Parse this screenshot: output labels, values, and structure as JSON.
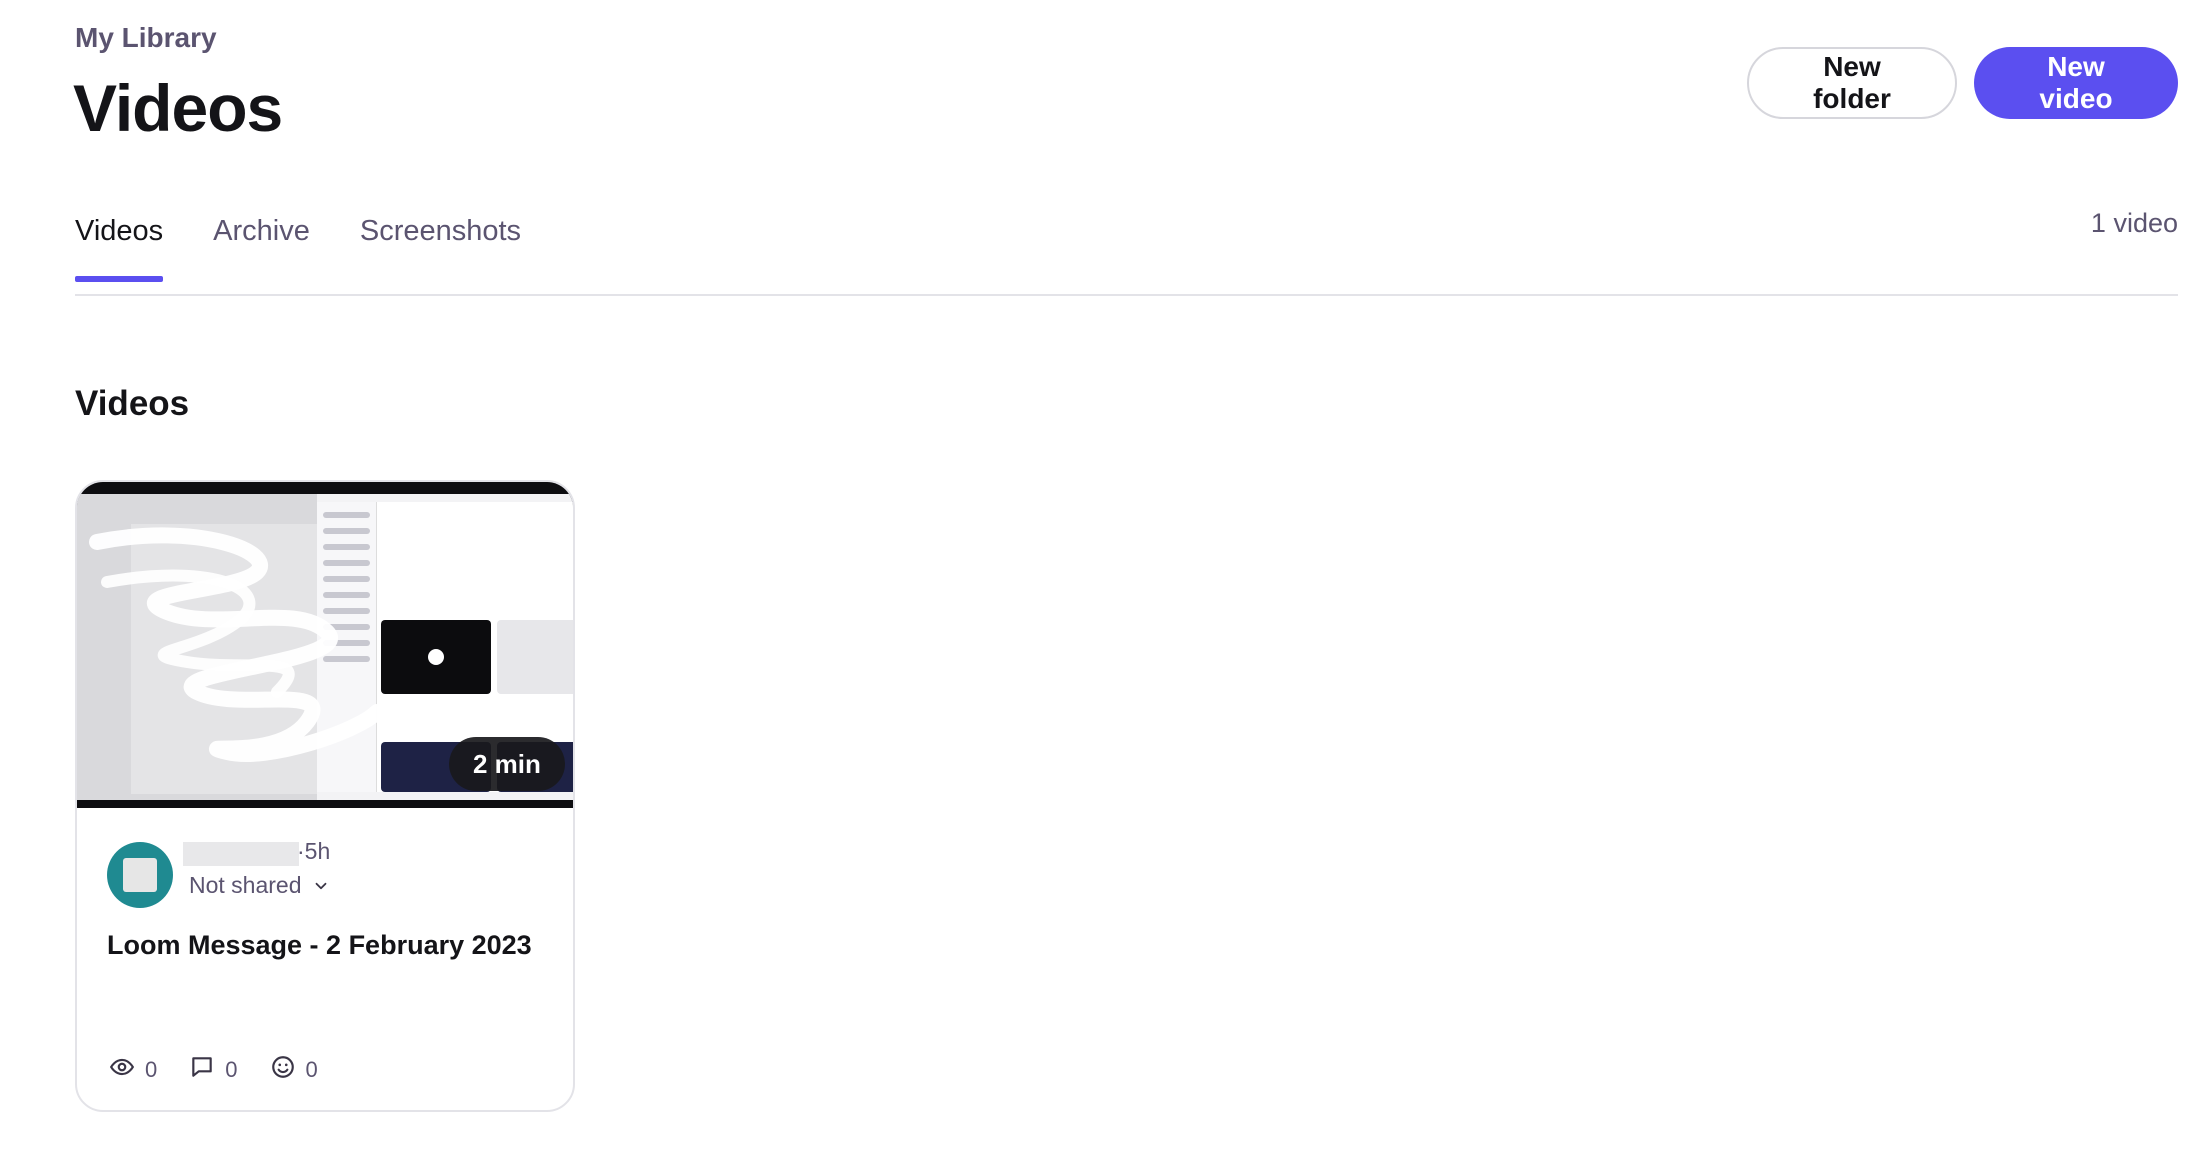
{
  "header": {
    "breadcrumb": "My Library",
    "title": "Videos",
    "actions": {
      "new_folder": "New folder",
      "new_video": "New video"
    }
  },
  "tabs": [
    {
      "label": "Videos",
      "active": true
    },
    {
      "label": "Archive",
      "active": false
    },
    {
      "label": "Screenshots",
      "active": false
    }
  ],
  "video_count": "1 video",
  "section": {
    "title": "Videos"
  },
  "videos": [
    {
      "duration": "2 min",
      "time_ago": "·5h",
      "share_status": "Not shared",
      "title": "Loom Message - 2 February 2023",
      "views": "0",
      "comments": "0",
      "reactions": "0"
    }
  ],
  "colors": {
    "accent": "#5b4ff0",
    "avatar": "#1f8a91",
    "muted_text": "#5b5470"
  },
  "icons": {
    "views": "eye-icon",
    "comments": "comment-icon",
    "reactions": "smiley-icon",
    "share_dropdown": "chevron-down-icon"
  }
}
